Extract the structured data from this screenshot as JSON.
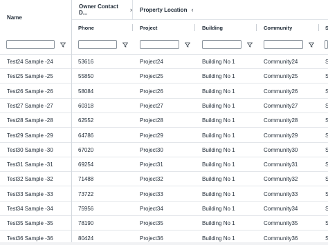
{
  "columns": {
    "name": "Name",
    "group_owner": "Owner Contact D...",
    "group_owner_chevron": "›",
    "group_property": "Property Location",
    "group_property_chevron": "‹",
    "phone": "Phone",
    "project": "Project",
    "building": "Building",
    "community": "Community",
    "cut": "S"
  },
  "icons": {
    "filter": "filter-icon"
  },
  "rows": [
    {
      "name": "Test24 Sample -24",
      "phone": "53616",
      "project": "Project24",
      "building": "Building No 1",
      "community": "Community24",
      "cut": "S"
    },
    {
      "name": "Test25 Sample -25",
      "phone": "55850",
      "project": "Project25",
      "building": "Building No 1",
      "community": "Community25",
      "cut": "S"
    },
    {
      "name": "Test26 Sample -26",
      "phone": "58084",
      "project": "Project26",
      "building": "Building No 1",
      "community": "Community26",
      "cut": "S"
    },
    {
      "name": "Test27 Sample -27",
      "phone": "60318",
      "project": "Project27",
      "building": "Building No 1",
      "community": "Community27",
      "cut": "S"
    },
    {
      "name": "Test28 Sample -28",
      "phone": "62552",
      "project": "Project28",
      "building": "Building No 1",
      "community": "Community28",
      "cut": "S"
    },
    {
      "name": "Test29 Sample -29",
      "phone": "64786",
      "project": "Project29",
      "building": "Building No 1",
      "community": "Community29",
      "cut": "S"
    },
    {
      "name": "Test30 Sample -30",
      "phone": "67020",
      "project": "Project30",
      "building": "Building No 1",
      "community": "Community30",
      "cut": "S"
    },
    {
      "name": "Test31 Sample -31",
      "phone": "69254",
      "project": "Project31",
      "building": "Building No 1",
      "community": "Community31",
      "cut": "S"
    },
    {
      "name": "Test32 Sample -32",
      "phone": "71488",
      "project": "Project32",
      "building": "Building No 1",
      "community": "Community32",
      "cut": "S"
    },
    {
      "name": "Test33 Sample -33",
      "phone": "73722",
      "project": "Project33",
      "building": "Building No 1",
      "community": "Community33",
      "cut": "S"
    },
    {
      "name": "Test34 Sample -34",
      "phone": "75956",
      "project": "Project34",
      "building": "Building No 1",
      "community": "Community34",
      "cut": "S"
    },
    {
      "name": "Test35 Sample -35",
      "phone": "78190",
      "project": "Project35",
      "building": "Building No 1",
      "community": "Community35",
      "cut": "S"
    },
    {
      "name": "Test36 Sample -36",
      "phone": "80424",
      "project": "Project36",
      "building": "Building No 1",
      "community": "Community36",
      "cut": "S"
    }
  ]
}
